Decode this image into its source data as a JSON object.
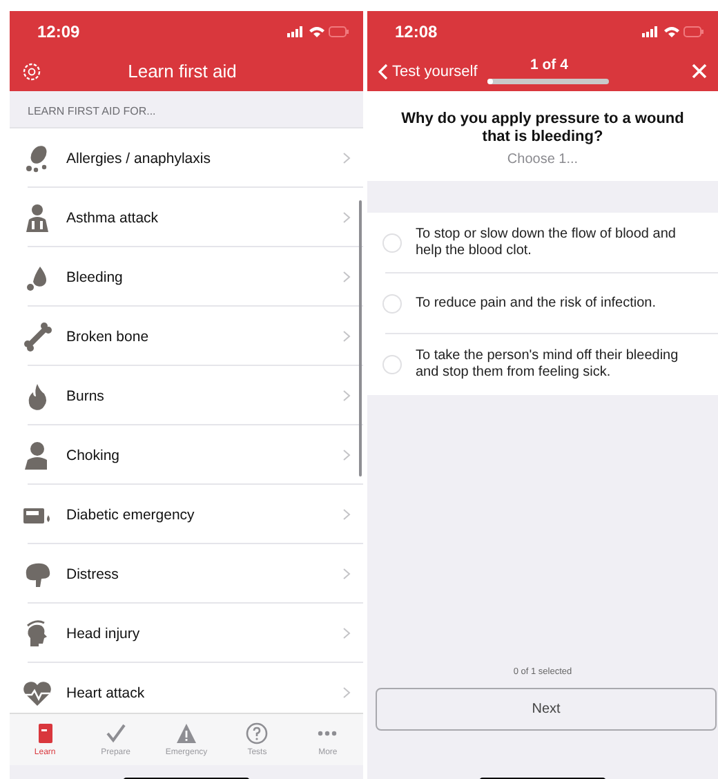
{
  "left_screen": {
    "status_bar": {
      "time": "12:09"
    },
    "nav": {
      "title": "Learn first aid"
    },
    "section_header": "LEARN FIRST AID FOR...",
    "topics": [
      {
        "label": "Allergies / anaphylaxis"
      },
      {
        "label": "Asthma attack"
      },
      {
        "label": "Bleeding"
      },
      {
        "label": "Broken bone"
      },
      {
        "label": "Burns"
      },
      {
        "label": "Choking"
      },
      {
        "label": "Diabetic emergency"
      },
      {
        "label": "Distress"
      },
      {
        "label": "Head injury"
      },
      {
        "label": "Heart attack"
      }
    ],
    "tab_bar": [
      {
        "label": "Learn",
        "selected": true
      },
      {
        "label": "Prepare",
        "selected": false
      },
      {
        "label": "Emergency",
        "selected": false
      },
      {
        "label": "Tests",
        "selected": false
      },
      {
        "label": "More",
        "selected": false
      }
    ]
  },
  "right_screen": {
    "status_bar": {
      "time": "12:08"
    },
    "nav": {
      "back": "Test yourself",
      "counter": "1 of 4",
      "progress": {
        "level": 0.03
      }
    },
    "question": "Why do you apply pressure to a wound that is bleeding?",
    "instruction": "Choose 1...",
    "answers": [
      {
        "text": "To stop or slow down the flow of blood and help the blood clot.",
        "selected": false
      },
      {
        "text": "To reduce pain and the risk of infection.",
        "selected": false
      },
      {
        "text": "To take the person's mind off their bleeding and stop them from feeling sick.",
        "selected": false
      }
    ],
    "selection_count": "0 of 1 selected",
    "next_button": "Next"
  }
}
